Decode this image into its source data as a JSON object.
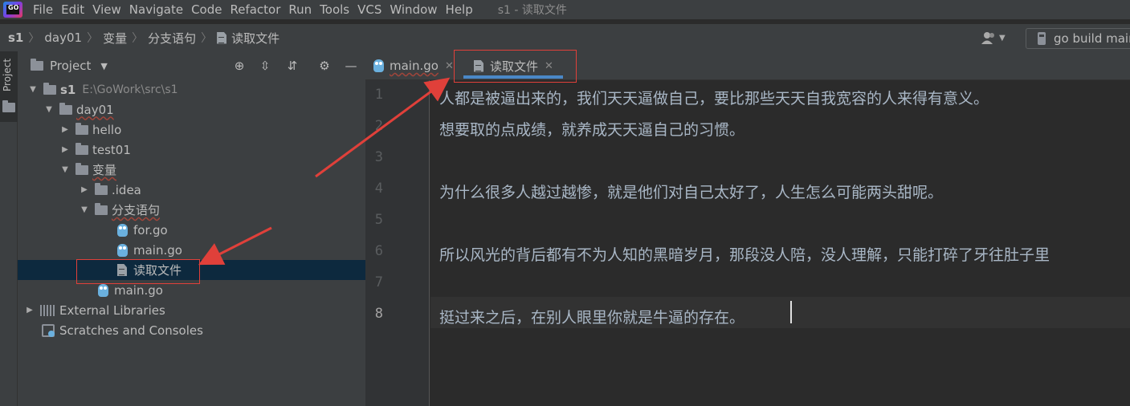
{
  "app": {
    "logo_text": "GO",
    "window_title": "s1 - 读取文件"
  },
  "menu": [
    "File",
    "Edit",
    "View",
    "Navigate",
    "Code",
    "Refactor",
    "Run",
    "Tools",
    "VCS",
    "Window",
    "Help"
  ],
  "breadcrumb": [
    "s1",
    "day01",
    "变量",
    "分支语句",
    "读取文件"
  ],
  "run_config": "go build main",
  "project_panel": {
    "title": "Project",
    "tree": [
      {
        "label": "s1",
        "hint": "E:\\GoWork\\src\\s1"
      },
      {
        "label": "day01"
      },
      {
        "label": "hello"
      },
      {
        "label": "test01"
      },
      {
        "label": "变量"
      },
      {
        "label": ".idea"
      },
      {
        "label": "分支语句"
      },
      {
        "label": "for.go"
      },
      {
        "label": "main.go"
      },
      {
        "label": "读取文件"
      },
      {
        "label": "main.go"
      },
      {
        "label": "External Libraries"
      },
      {
        "label": "Scratches and Consoles"
      }
    ]
  },
  "toolstrip": {
    "label": "Project"
  },
  "tabs": [
    {
      "label": "main.go"
    },
    {
      "label": "读取文件"
    }
  ],
  "editor": {
    "line_numbers": [
      "1",
      "2",
      "3",
      "4",
      "5",
      "6",
      "7",
      "8"
    ],
    "lines": [
      "人都是被逼出来的，我们天天逼做自己，要比那些天天自我宽容的人来得有意义。",
      "想要取的点成绩，就养成天天逼自己的习惯。",
      "",
      "为什么很多人越过越惨，就是他们对自己太好了，人生怎么可能两头甜呢。",
      "",
      "所以风光的背后都有不为人知的黑暗岁月，那段没人陪，没人理解，只能打碎了牙往肚子里",
      "",
      "挺过来之后，在别人眼里你就是牛逼的存在。"
    ],
    "current_line": 8
  },
  "colors": {
    "annotation": "#e0403a",
    "tab_underline": "#4a88c7",
    "selection": "#0d293e"
  },
  "icons": {
    "locate": "crosshair-icon",
    "expand": "expand-all-icon",
    "collapse": "collapse-all-icon",
    "settings": "gear-icon",
    "hide": "minimize-icon"
  }
}
